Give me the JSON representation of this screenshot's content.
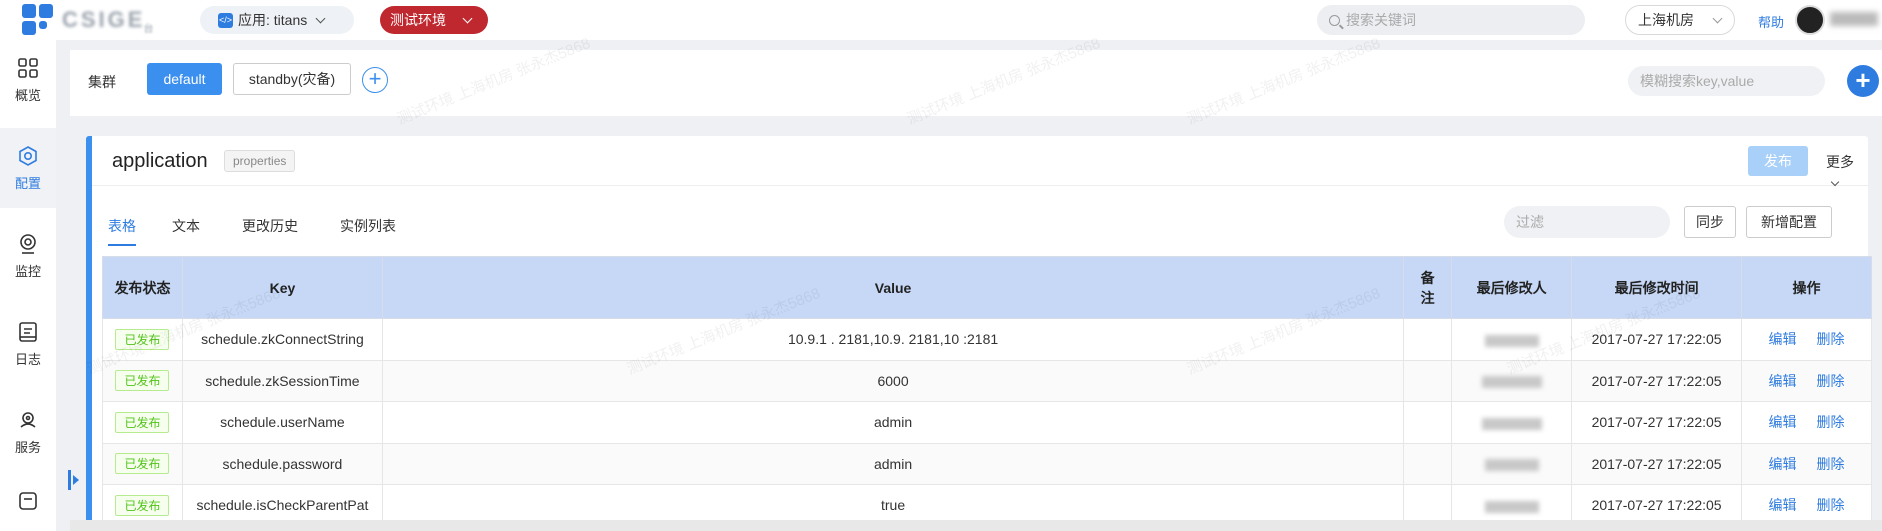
{
  "header": {
    "app_label": "应用: titans",
    "env_label": "测试环境",
    "search_placeholder": "搜索关键词",
    "room_label": "上海机房",
    "help_label": "帮助"
  },
  "sidebar": {
    "items": [
      {
        "label": "概览",
        "icon": "grid-icon"
      },
      {
        "label": "配置",
        "icon": "gear-icon"
      },
      {
        "label": "监控",
        "icon": "monitor-icon"
      },
      {
        "label": "日志",
        "icon": "log-icon"
      },
      {
        "label": "服务",
        "icon": "service-icon"
      }
    ]
  },
  "cluster": {
    "label": "集群",
    "clusters": [
      "default",
      "standby(灾备)"
    ],
    "filter_placeholder": "模糊搜索key,value"
  },
  "namespace": {
    "title": "application",
    "format_tag": "properties",
    "publish_label": "发布",
    "more_label": "更多"
  },
  "tabs": [
    "表格",
    "文本",
    "更改历史",
    "实例列表"
  ],
  "toolbar": {
    "filter_placeholder": "过滤",
    "sync_label": "同步",
    "new_label": "新增配置"
  },
  "table": {
    "headers": [
      "发布状态",
      "Key",
      "Value",
      "备注",
      "最后修改人",
      "最后修改时间",
      "操作"
    ],
    "edit_label": "编辑",
    "delete_label": "删除",
    "rows": [
      {
        "status": "已发布",
        "key": "schedule.zkConnectString",
        "value": "10.9.1 . 2181,10.9. 2181,10 :2181",
        "note": "",
        "modified": "2017-07-27 17:22:05"
      },
      {
        "status": "已发布",
        "key": "schedule.zkSessionTime",
        "value": "6000",
        "note": "",
        "modified": "2017-07-27 17:22:05"
      },
      {
        "status": "已发布",
        "key": "schedule.userName",
        "value": "admin",
        "note": "",
        "modified": "2017-07-27 17:22:05"
      },
      {
        "status": "已发布",
        "key": "schedule.password",
        "value": "admin",
        "note": "",
        "modified": "2017-07-27 17:22:05"
      },
      {
        "status": "已发布",
        "key": "schedule.isCheckParentPat",
        "value": "true",
        "note": "",
        "modified": "2017-07-27 17:22:05"
      }
    ]
  },
  "watermark_text": "测试环境 上海机房 张永杰5868"
}
